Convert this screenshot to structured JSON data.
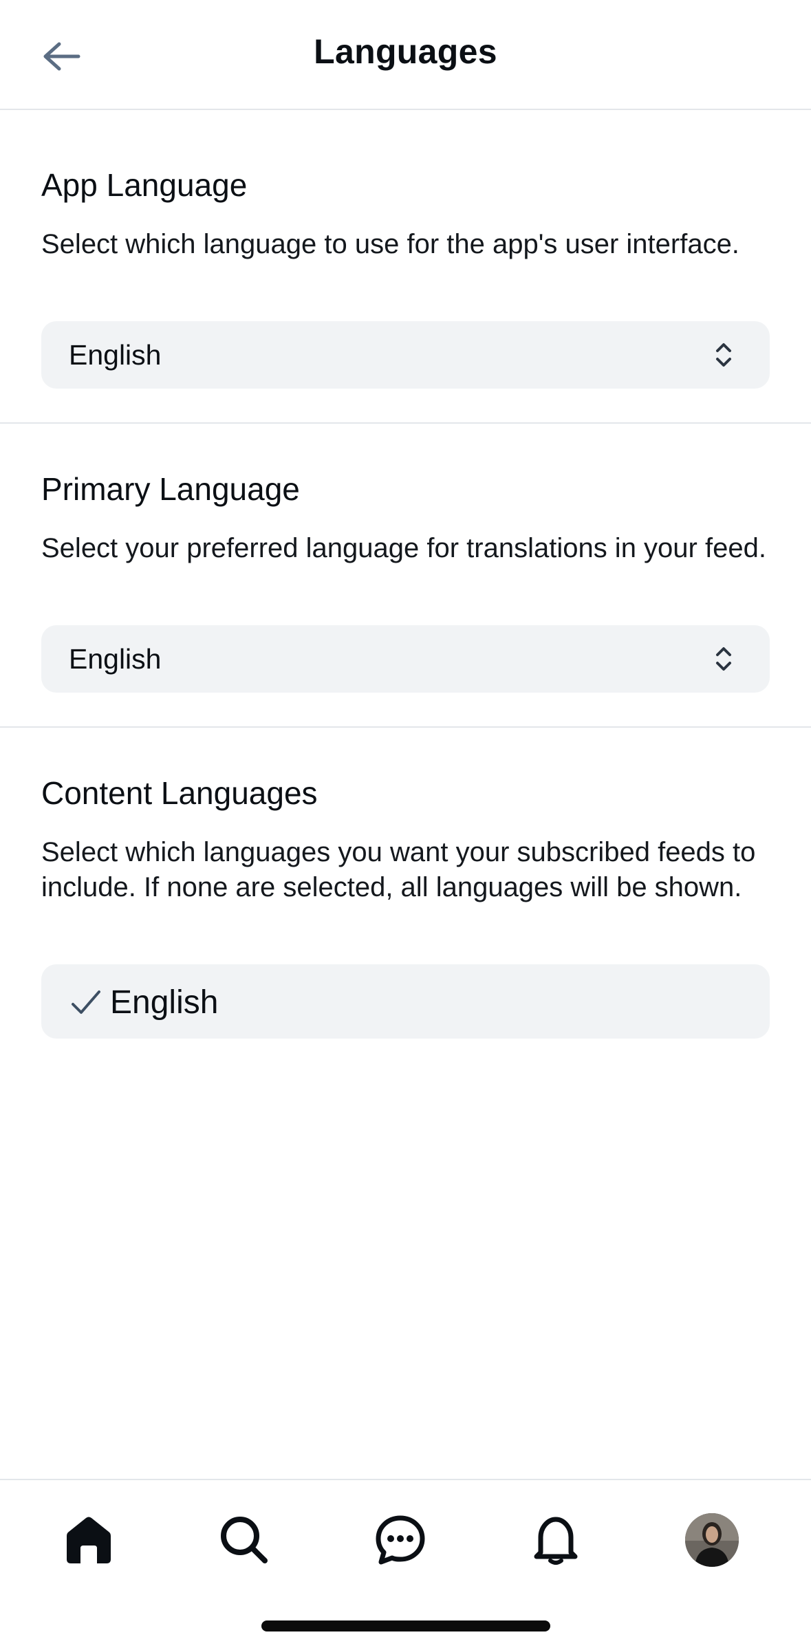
{
  "header": {
    "title": "Languages",
    "back_icon": "arrow-left-icon"
  },
  "app_language": {
    "title": "App Language",
    "description": "Select which language to use for the app's user interface.",
    "selected": "English"
  },
  "primary_language": {
    "title": "Primary Language",
    "description": "Select your preferred language for translations in your feed.",
    "selected": "English"
  },
  "content_languages": {
    "title": "Content Languages",
    "description": "Select which languages you want your subscribed feeds to include. If none are selected, all languages will be shown.",
    "items": [
      {
        "label": "English",
        "checked": true
      }
    ]
  },
  "tabbar": {
    "tabs": [
      "home-icon",
      "search-icon",
      "chat-icon",
      "bell-icon",
      "avatar"
    ],
    "active": "home"
  },
  "colors": {
    "text": "#0b0f14",
    "divider": "#e3e6ea",
    "input_bg": "#f1f3f5",
    "back_arrow": "#5b6d83"
  }
}
